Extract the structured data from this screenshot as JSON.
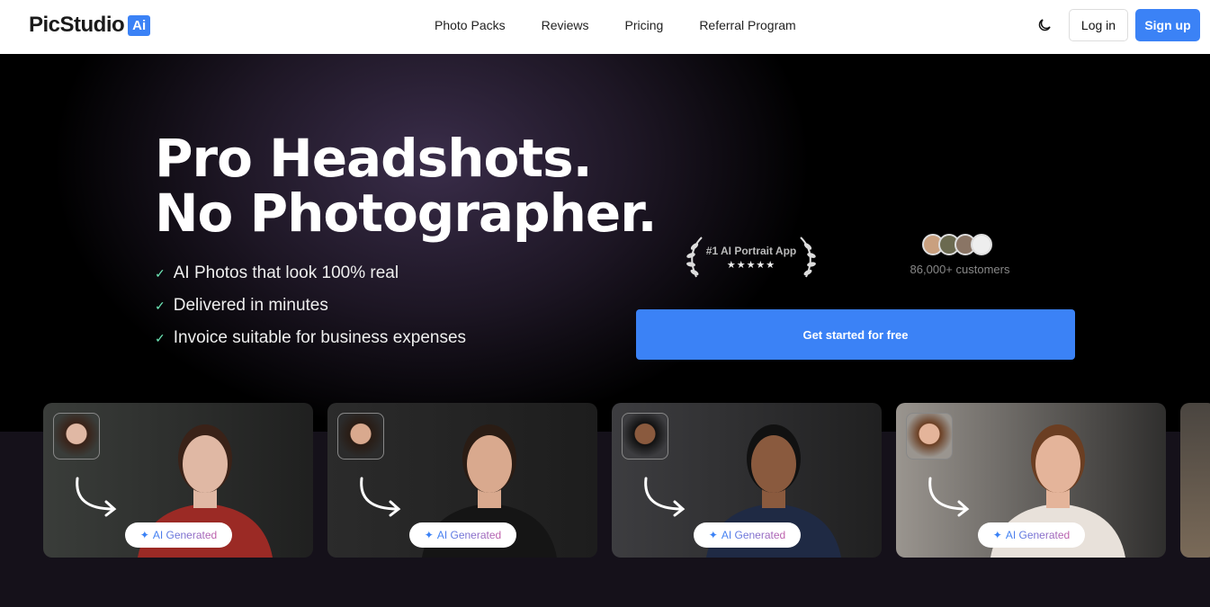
{
  "nav": {
    "brand": "PicStudio",
    "brand_badge": "Ai",
    "links": [
      "Photo Packs",
      "Reviews",
      "Pricing",
      "Referral Program"
    ],
    "login": "Log in",
    "signup": "Sign up",
    "theme_icon": "moon-icon"
  },
  "hero": {
    "title_line1": "Pro Headshots.",
    "title_line2": "No Photographer.",
    "features": [
      "AI Photos that look 100% real",
      "Delivered in minutes",
      "Invoice suitable for business expenses"
    ],
    "award": {
      "title": "#1 AI Portrait App",
      "stars": "★★★★★",
      "rating": 5
    },
    "customers": "86,000+ customers",
    "cta": "Get started for free"
  },
  "cards": [
    {
      "label": "AI Generated",
      "bg": "#3a3d3a",
      "shirt": "#9b2a25",
      "skin": "#e0b8a4",
      "hair": "#3a2218"
    },
    {
      "label": "AI Generated",
      "bg": "#2b2b2b",
      "shirt": "#151515",
      "skin": "#d9a98e",
      "hair": "#2a1c14"
    },
    {
      "label": "AI Generated",
      "bg": "#3d3d40",
      "shirt": "#1f2a44",
      "skin": "#8a5a3e",
      "hair": "#111"
    },
    {
      "label": "AI Generated",
      "bg": "#9a958f",
      "shirt": "#e8e1da",
      "skin": "#e4b49a",
      "hair": "#6b3e22"
    }
  ],
  "colors": {
    "accent": "#3b82f6",
    "check": "#6ee7b7"
  }
}
